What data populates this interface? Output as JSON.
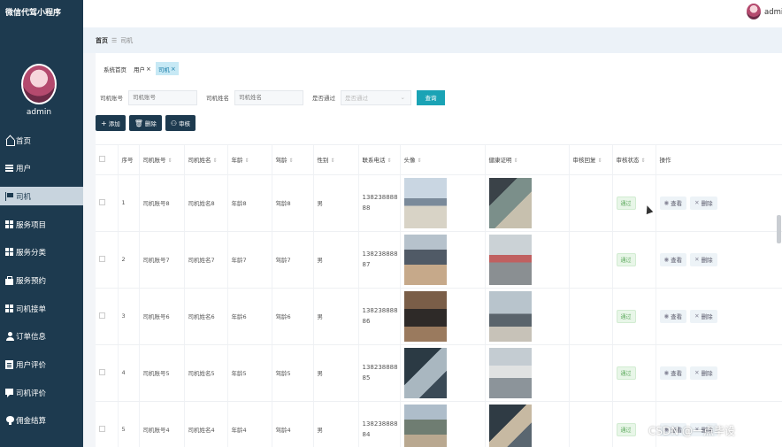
{
  "app": {
    "title": "微信代驾小程序"
  },
  "sidebar": {
    "username": "admin",
    "items": [
      {
        "label": "首页",
        "icon": "home-icon"
      },
      {
        "label": "用户",
        "icon": "list-icon"
      },
      {
        "label": "司机",
        "icon": "flag-icon",
        "active": true
      },
      {
        "label": "服务项目",
        "icon": "grid-icon"
      },
      {
        "label": "服务分类",
        "icon": "grid-icon"
      },
      {
        "label": "服务预约",
        "icon": "bag-icon"
      },
      {
        "label": "司机接单",
        "icon": "grid-icon"
      },
      {
        "label": "订单信息",
        "icon": "person-icon"
      },
      {
        "label": "用户评价",
        "icon": "doc-icon"
      },
      {
        "label": "司机评价",
        "icon": "chat-icon"
      },
      {
        "label": "佣金结算",
        "icon": "money-icon"
      }
    ]
  },
  "header": {
    "username": "admin"
  },
  "breadcrumb": {
    "home": "首页",
    "separator": "☰",
    "current": "司机"
  },
  "tabs": [
    {
      "label": "系统首页",
      "closable": false
    },
    {
      "label": "用户",
      "closable": true
    },
    {
      "label": "司机",
      "closable": true,
      "active": true
    }
  ],
  "filter": {
    "account_label": "司机账号",
    "account_placeholder": "司机账号",
    "name_label": "司机姓名",
    "name_placeholder": "司机姓名",
    "approved_label": "是否通过",
    "approved_placeholder": "是否通过",
    "query_button": "查询"
  },
  "toolbar": {
    "add": "添加",
    "delete": "删除",
    "review": "审核"
  },
  "table": {
    "columns": {
      "index": "序号",
      "account": "司机账号",
      "name": "司机姓名",
      "age": "年龄",
      "driving_years": "驾龄",
      "gender": "性别",
      "phone": "联系电话",
      "avatar": "头像",
      "health_cert": "健康证明",
      "review_reply": "审核回复",
      "review_status": "审核状态",
      "operation": "操作"
    },
    "view_label": "查看",
    "delete_label": "删除",
    "rows": [
      {
        "index": "1",
        "account": "司机账号8",
        "name": "司机姓名8",
        "age": "年龄8",
        "driving_years": "驾龄8",
        "gender": "男",
        "phone_a": "138238888",
        "phone_b": "88",
        "status": "通过"
      },
      {
        "index": "2",
        "account": "司机账号7",
        "name": "司机姓名7",
        "age": "年龄7",
        "driving_years": "驾龄7",
        "gender": "男",
        "phone_a": "138238888",
        "phone_b": "87",
        "status": "通过"
      },
      {
        "index": "3",
        "account": "司机账号6",
        "name": "司机姓名6",
        "age": "年龄6",
        "driving_years": "驾龄6",
        "gender": "男",
        "phone_a": "138238888",
        "phone_b": "86",
        "status": "通过"
      },
      {
        "index": "4",
        "account": "司机账号5",
        "name": "司机姓名5",
        "age": "年龄5",
        "driving_years": "驾龄5",
        "gender": "男",
        "phone_a": "138238888",
        "phone_b": "85",
        "status": "通过"
      },
      {
        "index": "5",
        "account": "司机账号4",
        "name": "司机姓名4",
        "age": "年龄4",
        "driving_years": "驾龄4",
        "gender": "男",
        "phone_a": "138238888",
        "phone_b": "84",
        "status": "通过"
      }
    ]
  },
  "watermark": "CSDN @一点毕设",
  "colors": {
    "sidebar": "#1d3a4f",
    "accent": "#1aa3b5",
    "active_tab": "#c7e9f5"
  }
}
